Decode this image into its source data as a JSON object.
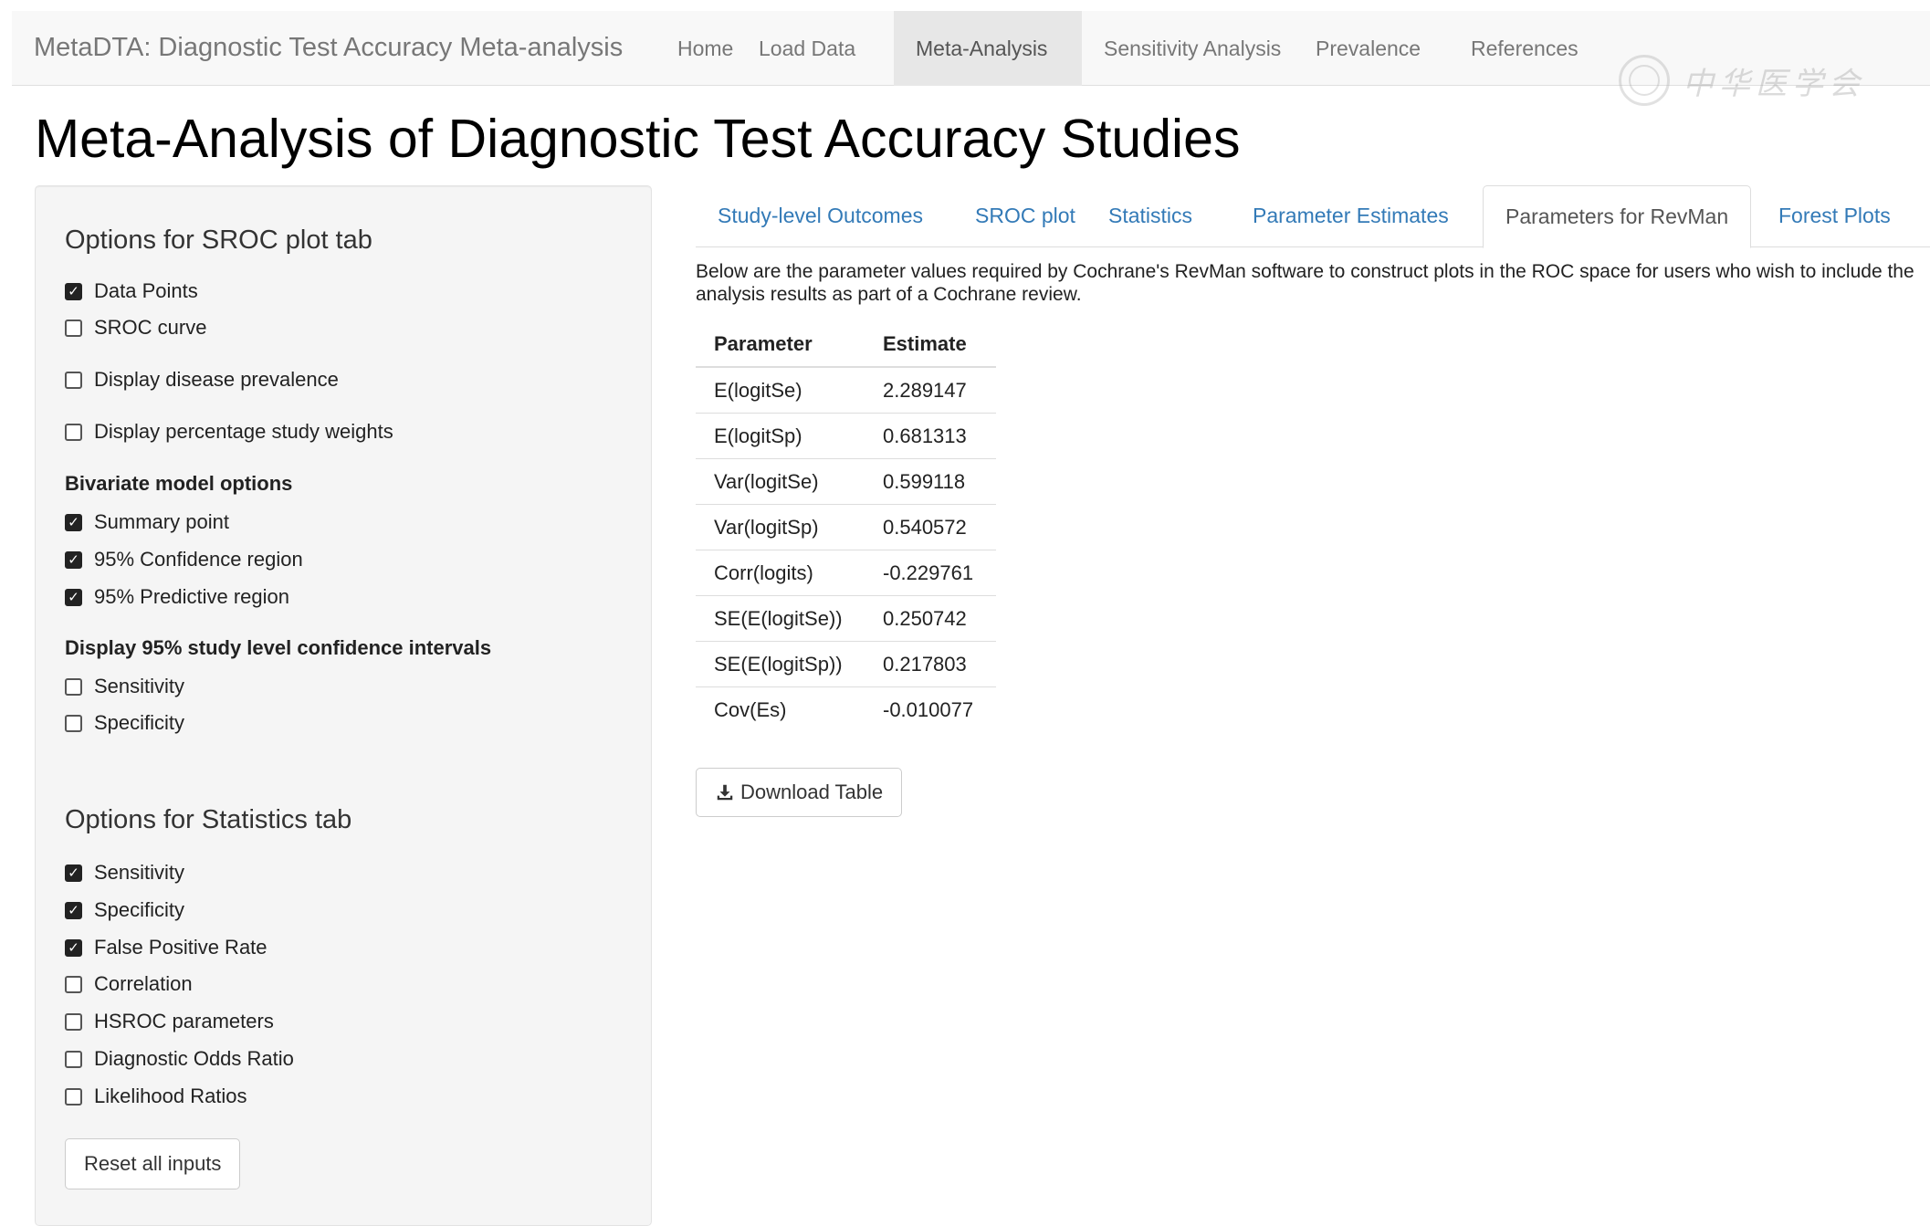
{
  "navbar": {
    "brand": "MetaDTA: Diagnostic Test Accuracy Meta-analysis",
    "items": [
      {
        "label": "Home",
        "active": false
      },
      {
        "label": "Load Data",
        "active": false
      },
      {
        "label": "Meta-Analysis",
        "active": true
      },
      {
        "label": "Sensitivity Analysis",
        "active": false
      },
      {
        "label": "Prevalence",
        "active": false
      },
      {
        "label": "References",
        "active": false
      }
    ]
  },
  "page_title": "Meta-Analysis of Diagnostic Test Accuracy Studies",
  "sidebar": {
    "sroc_heading": "Options for SROC plot tab",
    "sroc_options": [
      {
        "label": "Data Points",
        "checked": true
      },
      {
        "label": "SROC curve",
        "checked": false
      },
      {
        "label": "Display disease prevalence",
        "checked": false
      },
      {
        "label": "Display percentage study weights",
        "checked": false
      }
    ],
    "bivariate_heading": "Bivariate model options",
    "bivariate_options": [
      {
        "label": "Summary point",
        "checked": true
      },
      {
        "label": "95% Confidence region",
        "checked": true
      },
      {
        "label": "95% Predictive region",
        "checked": true
      }
    ],
    "ci_heading": "Display 95% study level confidence intervals",
    "ci_options": [
      {
        "label": "Sensitivity",
        "checked": false
      },
      {
        "label": "Specificity",
        "checked": false
      }
    ],
    "stats_heading": "Options for Statistics tab",
    "stats_options": [
      {
        "label": "Sensitivity",
        "checked": true
      },
      {
        "label": "Specificity",
        "checked": true
      },
      {
        "label": "False Positive Rate",
        "checked": true
      },
      {
        "label": "Correlation",
        "checked": false
      },
      {
        "label": "HSROC parameters",
        "checked": false
      },
      {
        "label": "Diagnostic Odds Ratio",
        "checked": false
      },
      {
        "label": "Likelihood Ratios",
        "checked": false
      }
    ],
    "reset_label": "Reset all inputs"
  },
  "tabs": [
    {
      "label": "Study-level Outcomes",
      "active": false
    },
    {
      "label": "SROC plot",
      "active": false
    },
    {
      "label": "Statistics",
      "active": false
    },
    {
      "label": "Parameter Estimates",
      "active": false
    },
    {
      "label": "Parameters for RevMan",
      "active": true
    },
    {
      "label": "Forest Plots",
      "active": false
    }
  ],
  "main": {
    "description": "Below are the parameter values required by Cochrane's RevMan software to construct plots in the ROC space for users who wish to include the analysis results as part of a Cochrane review.",
    "table": {
      "headers": [
        "Parameter",
        "Estimate"
      ],
      "rows": [
        [
          "E(logitSe)",
          "2.289147"
        ],
        [
          "E(logitSp)",
          "0.681313"
        ],
        [
          "Var(logitSe)",
          "0.599118"
        ],
        [
          "Var(logitSp)",
          "0.540572"
        ],
        [
          "Corr(logits)",
          "-0.229761"
        ],
        [
          "SE(E(logitSe))",
          "0.250742"
        ],
        [
          "SE(E(logitSp))",
          "0.217803"
        ],
        [
          "Cov(Es)",
          "-0.010077"
        ]
      ]
    },
    "download_label": "Download Table"
  },
  "icons": {
    "download": "download-icon",
    "checkbox": "checkbox-icon"
  },
  "colors": {
    "link": "#337ab7",
    "navbar_bg": "#f8f8f8",
    "active_nav_bg": "#e7e7e7",
    "well_bg": "#f5f5f5"
  }
}
